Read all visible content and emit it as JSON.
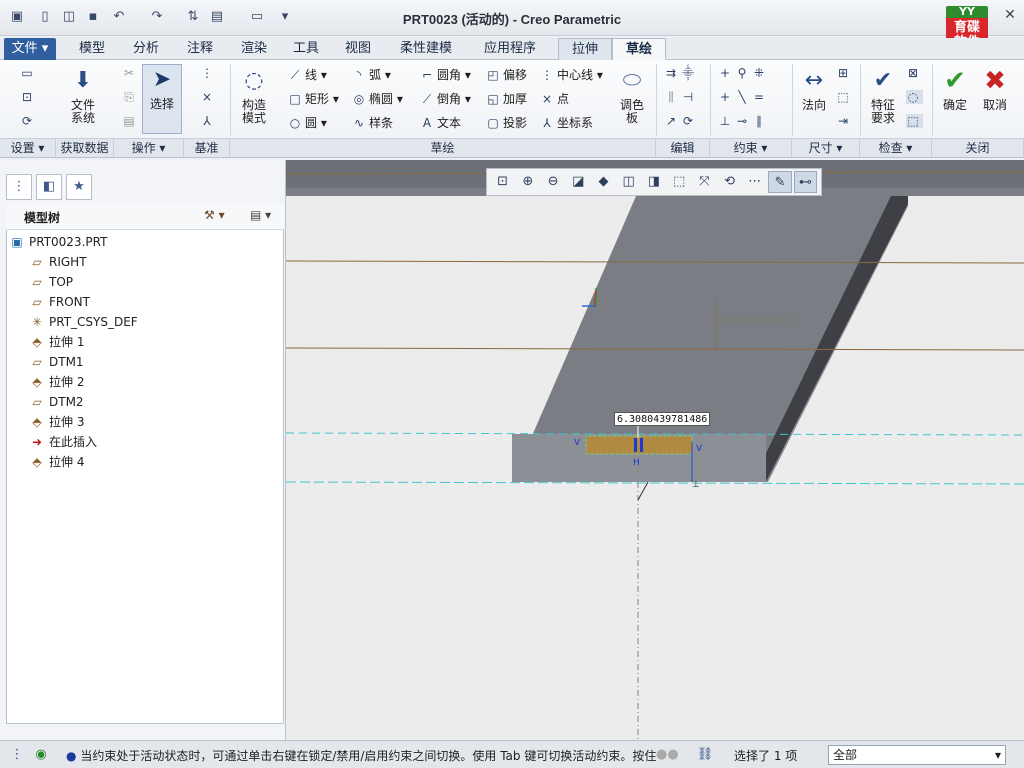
{
  "window": {
    "title": "PRT0023 (活动的) - Creo Parametric"
  },
  "logo": {
    "top": "YY",
    "line1": "育碟",
    "line2": "软件"
  },
  "menu_tabs": [
    "文件",
    "模型",
    "分析",
    "注释",
    "渲染",
    "工具",
    "视图",
    "柔性建模",
    "应用程序",
    "拉伸",
    "草绘"
  ],
  "ribbon": {
    "groups": [
      "设置",
      "获取数据",
      "操作",
      "基准",
      "草绘",
      "编辑",
      "约束",
      "尺寸",
      "检查",
      "关闭"
    ],
    "file_system": "文件\n系统",
    "select": "选择",
    "construct_mode": "构造\n模式",
    "palette": "调色\n板",
    "normal": "法向",
    "feature_req": "特征\n要求",
    "ok": "确定",
    "cancel": "取消",
    "sketch_tools": {
      "line": "线",
      "rect": "矩形",
      "circle": "圆",
      "arc": "弧",
      "ellipse": "椭圆",
      "spline": "样条",
      "fillet": "圆角",
      "chamfer": "倒角",
      "text": "文本",
      "offset": "偏移",
      "thicken": "加厚",
      "project": "投影",
      "centerline": "中心线",
      "point": "点",
      "csys": "坐标系"
    }
  },
  "model_tree": {
    "label": "模型树",
    "items": [
      {
        "name": "PRT0023.PRT",
        "icon": "part-icon"
      },
      {
        "name": "RIGHT",
        "icon": "datum-plane-icon"
      },
      {
        "name": "TOP",
        "icon": "datum-plane-icon"
      },
      {
        "name": "FRONT",
        "icon": "datum-plane-icon"
      },
      {
        "name": "PRT_CSYS_DEF",
        "icon": "csys-icon"
      },
      {
        "name": "拉伸 1",
        "icon": "extrude-icon"
      },
      {
        "name": "DTM1",
        "icon": "datum-plane-icon"
      },
      {
        "name": "拉伸 2",
        "icon": "extrude-icon"
      },
      {
        "name": "DTM2",
        "icon": "datum-plane-icon"
      },
      {
        "name": "拉伸 3",
        "icon": "extrude-icon"
      },
      {
        "name": "在此插入",
        "icon": "insert-arrow-icon"
      },
      {
        "name": "拉伸 4",
        "icon": "extrude-new-icon"
      }
    ]
  },
  "graphics": {
    "dimension_value": "6.3080439781486",
    "constraint_v": "V",
    "constraint_h": "H"
  },
  "status": {
    "message": "当约束处于活动状态时，可通过单击右键在锁定/禁用/启用约束之间切换。使用 Tab 键可切换活动约束。按住",
    "selected": "选择了 1 项",
    "filter": "全部"
  }
}
